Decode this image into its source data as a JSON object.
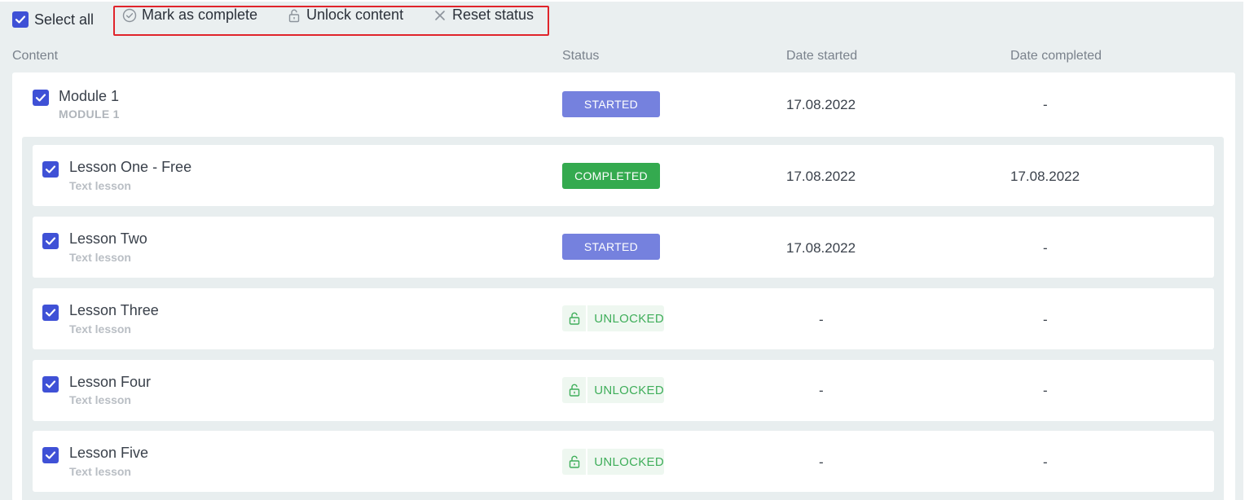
{
  "toolbar": {
    "select_all_label": "Select all",
    "actions": [
      {
        "label": "Mark as complete",
        "icon": "check-circle-icon"
      },
      {
        "label": "Unlock content",
        "icon": "unlock-icon"
      },
      {
        "label": "Reset status",
        "icon": "close-icon"
      }
    ]
  },
  "columns": {
    "content": "Content",
    "status": "Status",
    "date_started": "Date started",
    "date_completed": "Date completed"
  },
  "module": {
    "title": "Module 1",
    "subtitle": "MODULE 1",
    "status": "STARTED",
    "date_started": "17.08.2022",
    "date_completed": "-"
  },
  "lessons": [
    {
      "title": "Lesson One - Free",
      "subtitle": "Text lesson",
      "status": "COMPLETED",
      "date_started": "17.08.2022",
      "date_completed": "17.08.2022"
    },
    {
      "title": "Lesson Two",
      "subtitle": "Text lesson",
      "status": "STARTED",
      "date_started": "17.08.2022",
      "date_completed": "-"
    },
    {
      "title": "Lesson Three",
      "subtitle": "Text lesson",
      "status": "UNLOCKED",
      "date_started": "-",
      "date_completed": "-"
    },
    {
      "title": "Lesson Four",
      "subtitle": "Text lesson",
      "status": "UNLOCKED",
      "date_started": "-",
      "date_completed": "-"
    },
    {
      "title": "Lesson Five",
      "subtitle": "Text lesson",
      "status": "UNLOCKED",
      "date_started": "-",
      "date_completed": "-"
    }
  ],
  "colors": {
    "checkbox": "#3f51d6",
    "started": "#7581de",
    "completed": "#34aa4f",
    "unlocked": "#3fae5a",
    "highlight": "#e0242b"
  }
}
